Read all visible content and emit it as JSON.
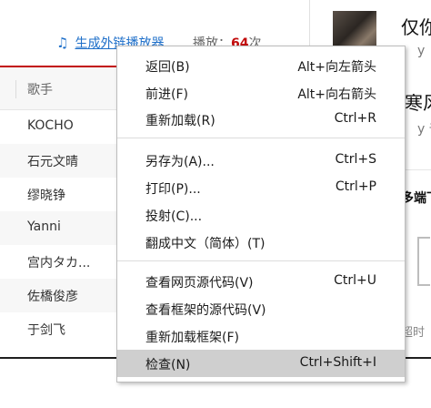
{
  "player": {
    "link_text": "生成外链播放器",
    "play_label": "播放：",
    "play_count": "64",
    "play_unit": "次"
  },
  "table": {
    "column_header": "歌手",
    "artists": [
      "KOCHO",
      "石元文晴",
      "缪晓铮",
      "Yanni",
      "宫内タカ...",
      "佐橋俊彦",
      "于剑飞"
    ]
  },
  "right_panel": {
    "title1": "仅你",
    "sub1": "y",
    "title2": "寒风",
    "sub2": "y 千",
    "label": "多端下",
    "footer": "超时"
  },
  "context_menu": {
    "items": [
      {
        "label": "返回(B)",
        "shortcut": "Alt+向左箭头"
      },
      {
        "label": "前进(F)",
        "shortcut": "Alt+向右箭头"
      },
      {
        "label": "重新加载(R)",
        "shortcut": "Ctrl+R"
      },
      {
        "label": "另存为(A)...",
        "shortcut": "Ctrl+S"
      },
      {
        "label": "打印(P)...",
        "shortcut": "Ctrl+P"
      },
      {
        "label": "投射(C)...",
        "shortcut": ""
      },
      {
        "label": "翻成中文（简体）(T)",
        "shortcut": ""
      },
      {
        "label": "查看网页源代码(V)",
        "shortcut": "Ctrl+U"
      },
      {
        "label": "查看框架的源代码(V)",
        "shortcut": ""
      },
      {
        "label": "重新加载框架(F)",
        "shortcut": ""
      },
      {
        "label": "检查(N)",
        "shortcut": "Ctrl+Shift+I"
      }
    ]
  },
  "colors": {
    "accent_red": "#c20c0c",
    "link_blue": "#1e6fc9",
    "menu_highlight": "#cfcfcf"
  },
  "icons": {
    "music": "music-note-icon"
  }
}
